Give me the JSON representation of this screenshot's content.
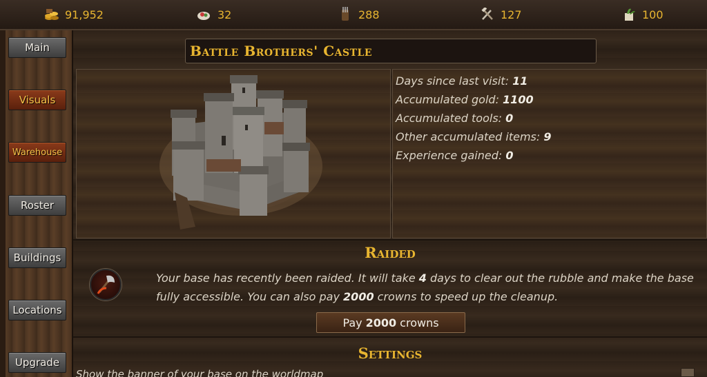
{
  "resources": {
    "gold": {
      "icon": "gold-coins-icon",
      "value": "91,952"
    },
    "food": {
      "icon": "food-provisions-icon",
      "value": "32"
    },
    "ammo": {
      "icon": "arrows-ammo-icon",
      "value": "288"
    },
    "tools": {
      "icon": "tools-hammer-icon",
      "value": "127"
    },
    "medicine": {
      "icon": "medicine-herbs-icon",
      "value": "100"
    }
  },
  "sidebar": {
    "items": [
      {
        "label": "Main",
        "active": false
      },
      {
        "label": "Visuals",
        "active": true
      },
      {
        "label": "Warehouse",
        "active": true
      },
      {
        "label": "Roster",
        "active": false
      },
      {
        "label": "Buildings",
        "active": false
      },
      {
        "label": "Locations",
        "active": false
      },
      {
        "label": "Upgrade",
        "active": false
      }
    ]
  },
  "base": {
    "title": "Battle Brothers' Castle",
    "stats": [
      {
        "label": "Days since last visit:",
        "value": "11"
      },
      {
        "label": "Accumulated gold:",
        "value": "1100"
      },
      {
        "label": "Accumulated tools:",
        "value": "0"
      },
      {
        "label": "Other accumulated items:",
        "value": "9"
      },
      {
        "label": "Experience gained:",
        "value": "0"
      }
    ]
  },
  "raided": {
    "heading": "Raided",
    "icon": "axe-raid-icon",
    "text_1": "Your base has recently been raided. It will take",
    "days": "4",
    "text_2": "days to clear out the rubble and make the base fully accessible. You can also pay",
    "cost": "2000",
    "text_3": "crowns to speed up the cleanup.",
    "button_prefix": "Pay",
    "button_amount": "2000",
    "button_suffix": "crowns"
  },
  "settings": {
    "heading": "Settings",
    "row_label": "Show the banner of your base on the worldmap"
  },
  "colors": {
    "accent": "#e8b530",
    "active_tab": "#8a3a1a"
  }
}
